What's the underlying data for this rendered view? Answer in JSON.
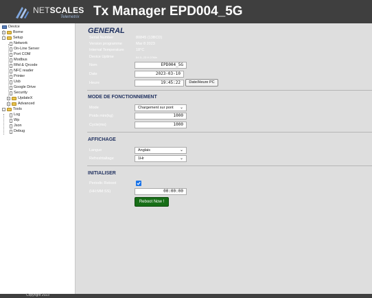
{
  "header": {
    "logo_name_plain": "NET",
    "logo_name_bold": "SCALES",
    "logo_sub": "Telemetrix",
    "title": "Tx Manager EPD004_5G"
  },
  "sidebar": {
    "items": [
      {
        "label": "Device"
      },
      {
        "label": "Borne"
      },
      {
        "label": "Setup"
      },
      {
        "label": "Network"
      },
      {
        "label": "On-Line Server"
      },
      {
        "label": "Port COM"
      },
      {
        "label": "Modbus"
      },
      {
        "label": "Rfid & Qrcode"
      },
      {
        "label": "NFC reader"
      },
      {
        "label": "Printer"
      },
      {
        "label": "Usb"
      },
      {
        "label": "Google Drive"
      },
      {
        "label": "Security"
      },
      {
        "label": "UpdateX"
      },
      {
        "label": "Advanced"
      },
      {
        "label": "Tools"
      },
      {
        "label": "Log"
      },
      {
        "label": "Wp"
      },
      {
        "label": "Json"
      },
      {
        "label": "Debug"
      }
    ]
  },
  "general": {
    "title": "GENERAL",
    "serial_label": "Serial Number",
    "serial_value": "80845 (13BCD)",
    "version_label": "Version programme",
    "version_value": "Mar 8 2023",
    "temp_label": "Internal Temperature",
    "temp_value": "18°C",
    "uptime_label": "Device Uptime",
    "uptime_value": "64 D, 23 H 07Min",
    "nom_label": "Nom",
    "nom_value": "EPD004_5G",
    "date_label": "Date",
    "date_value": "2023-03-10",
    "heure_label": "Heure",
    "heure_value": "19:45:22",
    "pc_button": "Date/Heure PC"
  },
  "mode": {
    "title": "MODE DE FONCTIONNEMENT",
    "mode_label": "Mode",
    "mode_value": "Chargement sur pont",
    "poids_label": "Poids mini(kg)",
    "poids_value": "1000",
    "cycle_label": "Cycle(ms)",
    "cycle_value": "1000"
  },
  "affichage": {
    "title": "AFFICHAGE",
    "langue_label": "Langue",
    "langue_value": "Anglais",
    "refresh_label": "Refreshtaltage",
    "refresh_value": "1Hr"
  },
  "initialiser": {
    "title": "INITIALISER",
    "periodic_label": "Periodic Reboot",
    "periodic_checked": true,
    "time_label": "(HH:MM:SS)",
    "time_value": "00:00:00",
    "reboot_button": "Reboot Now !"
  },
  "footer": {
    "text": "Copyright 2023"
  },
  "colors": {
    "header_bg": "#3f3f3f",
    "main_bg": "#dedede",
    "section_title": "#1e2f5e",
    "reboot_green": "#176e17",
    "checkbox_blue": "#1a73e8"
  }
}
